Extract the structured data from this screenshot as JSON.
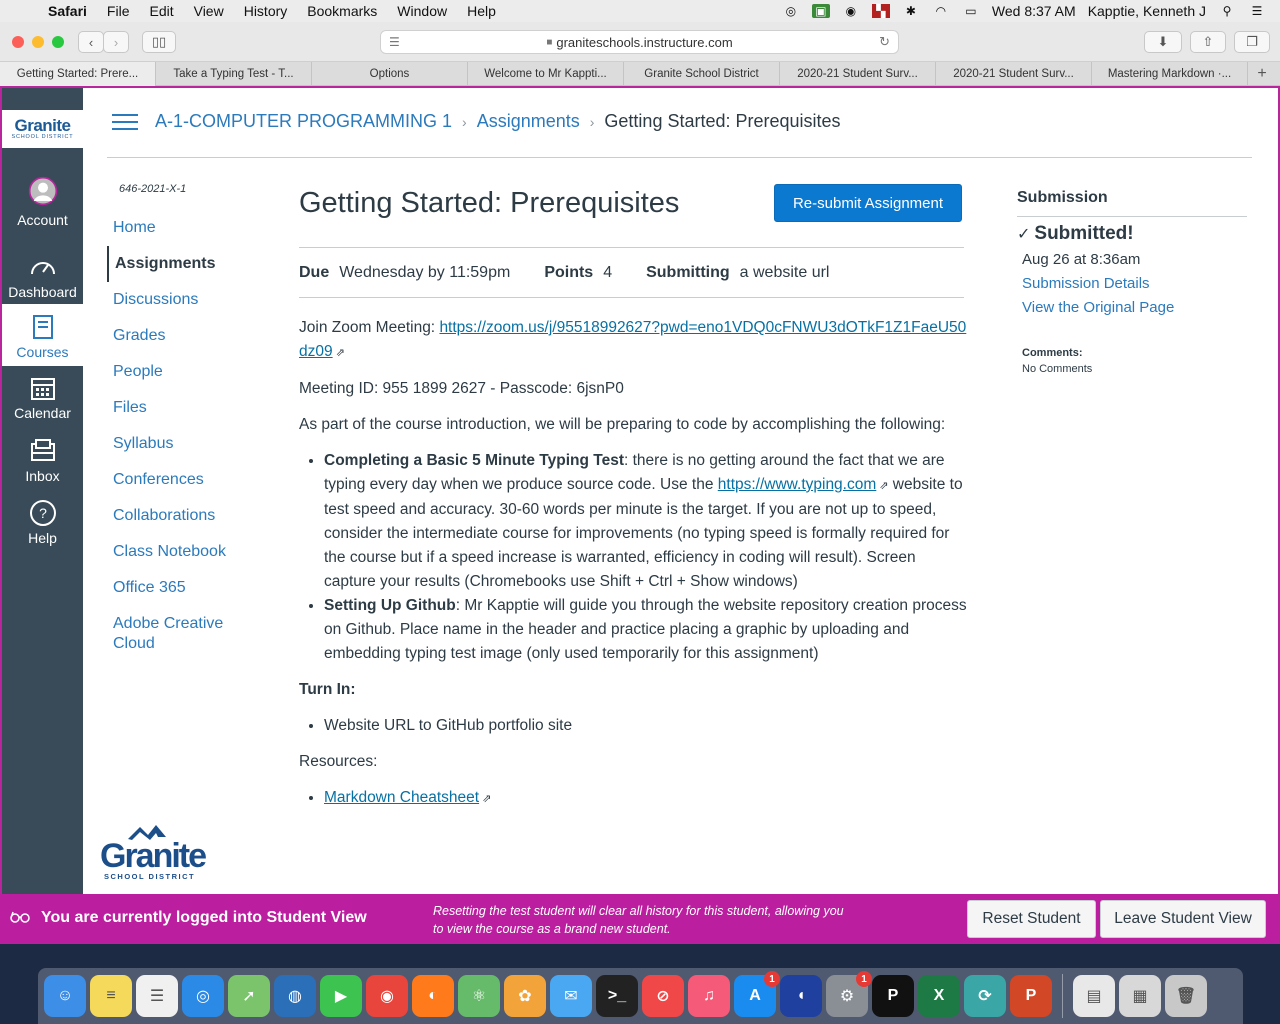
{
  "menubar": {
    "app": "Safari",
    "items": [
      "File",
      "Edit",
      "View",
      "History",
      "Bookmarks",
      "Window",
      "Help"
    ],
    "clock": "Wed 8:37 AM",
    "user": "Kapptie, Kenneth J"
  },
  "browser": {
    "url": "graniteschools.instructure.com",
    "tabs": [
      "Getting Started: Prere...",
      "Take a Typing Test - T...",
      "Options",
      "Welcome to Mr Kappti...",
      "Granite School District",
      "2020-21 Student Surv...",
      "2020-21 Student Surv...",
      "Mastering Markdown ·..."
    ]
  },
  "global_nav": {
    "logo_word": "Granite",
    "logo_sub": "SCHOOL DISTRICT",
    "items": [
      {
        "label": "Account",
        "icon": "avatar-icon"
      },
      {
        "label": "Dashboard",
        "icon": "dashboard-icon"
      },
      {
        "label": "Courses",
        "icon": "courses-icon"
      },
      {
        "label": "Calendar",
        "icon": "calendar-icon"
      },
      {
        "label": "Inbox",
        "icon": "inbox-icon"
      },
      {
        "label": "Help",
        "icon": "help-icon"
      }
    ]
  },
  "breadcrumb": {
    "course": "A-1-COMPUTER PROGRAMMING 1",
    "section": "Assignments",
    "current": "Getting Started: Prerequisites"
  },
  "course_nav": {
    "code": "646-2021-X-1",
    "items": [
      "Home",
      "Assignments",
      "Discussions",
      "Grades",
      "People",
      "Files",
      "Syllabus",
      "Conferences",
      "Collaborations",
      "Class Notebook",
      "Office 365",
      "Adobe Creative Cloud"
    ],
    "active": "Assignments"
  },
  "assignment": {
    "title": "Getting Started: Prerequisites",
    "resubmit_label": "Re-submit Assignment",
    "due_label": "Due",
    "due_value": "Wednesday by 11:59pm",
    "points_label": "Points",
    "points_value": "4",
    "submitting_label": "Submitting",
    "submitting_value": "a website url",
    "zoom_prefix": "Join Zoom Meeting: ",
    "zoom_link": "https://zoom.us/j/95518992627?pwd=eno1VDQ0cFNWU3dOTkF1Z1FaeU50dz09",
    "meeting_id": "Meeting ID: 955 1899 2627 - Passcode: 6jsnP0",
    "intro": "As part of the course introduction, we will be preparing to code by accomplishing the following:",
    "task1_title": "Completing a Basic 5 Minute Typing Test",
    "task1_text_a": ": there is no getting around the fact that we are typing every day when we produce source code. Use the ",
    "task1_link": "https://www.typing.com",
    "task1_text_b": " website to test speed and accuracy. 30-60 words per minute is the target. If you are not up to speed, consider the intermediate course for improvements (no typing speed is formally required for the course but if a speed increase is warranted, efficiency in coding will result). Screen capture your results (Chromebooks use Shift + Ctrl + Show windows)",
    "task2_title": "Setting Up Github",
    "task2_text": ": Mr Kapptie will guide you through the website repository creation process on Github. Place name in the header and practice placing a graphic by uploading and embedding typing test image (only used temporarily for this assignment)",
    "turnin_heading": "Turn In:",
    "turnin_item": "Website URL to GitHub portfolio site",
    "resources_heading": "Resources:",
    "resource_link": "Markdown Cheatsheet"
  },
  "submission": {
    "heading": "Submission",
    "status": "Submitted!",
    "date": "Aug 26 at 8:36am",
    "details_link": "Submission Details",
    "original_link": "View the Original Page",
    "comments_label": "Comments:",
    "comments_value": "No Comments"
  },
  "student_view": {
    "message": "You are currently logged into Student View",
    "note": "Resetting the test student will clear all history for this student, allowing you to view the course as a brand new student.",
    "reset_label": "Reset Student",
    "leave_label": "Leave Student View"
  },
  "dock": {
    "apps": [
      {
        "icon": "finder-icon",
        "color": "#3d8ee6",
        "glyph": "☺"
      },
      {
        "icon": "notes-icon",
        "color": "#f5d95a",
        "glyph": "≡"
      },
      {
        "icon": "reminders-icon",
        "color": "#f0f0f0",
        "glyph": "☰"
      },
      {
        "icon": "safari-icon",
        "color": "#2b8ae6",
        "glyph": "◎"
      },
      {
        "icon": "maps-icon",
        "color": "#7cc46c",
        "glyph": "➚"
      },
      {
        "icon": "network-icon",
        "color": "#2a6fb8",
        "glyph": "◍"
      },
      {
        "icon": "facetime-icon",
        "color": "#3cc350",
        "glyph": "▶"
      },
      {
        "icon": "chrome-icon",
        "color": "#e8453c",
        "glyph": "◉"
      },
      {
        "icon": "firefox-icon",
        "color": "#ff7a1a",
        "glyph": "◐"
      },
      {
        "icon": "atom-icon",
        "color": "#66bb6a",
        "glyph": "⚛"
      },
      {
        "icon": "photos-icon",
        "color": "#f2a43a",
        "glyph": "✿"
      },
      {
        "icon": "messages-icon",
        "color": "#4aa8f2",
        "glyph": "✉"
      },
      {
        "icon": "terminal-icon",
        "color": "#222222",
        "glyph": ">_"
      },
      {
        "icon": "news-icon",
        "color": "#f04848",
        "glyph": "⊘"
      },
      {
        "icon": "music-icon",
        "color": "#f55a78",
        "glyph": "♫"
      },
      {
        "icon": "appstore-icon",
        "color": "#1a8cf0",
        "glyph": "A",
        "badge": "1"
      },
      {
        "icon": "audacity-icon",
        "color": "#2040a0",
        "glyph": "◖"
      },
      {
        "icon": "system-preferences-icon",
        "color": "#8a8f96",
        "glyph": "⚙",
        "badge": "1"
      },
      {
        "icon": "processing-icon",
        "color": "#111111",
        "glyph": "P"
      },
      {
        "icon": "excel-icon",
        "color": "#1e7a44",
        "glyph": "X"
      },
      {
        "icon": "sync-icon",
        "color": "#3aa6a6",
        "glyph": "⟳"
      },
      {
        "icon": "powerpoint-icon",
        "color": "#d24726",
        "glyph": "P"
      },
      {
        "icon": "xls-file-icon",
        "color": "#e8e8e8",
        "glyph": "▤"
      },
      {
        "icon": "spreadsheet-file-icon",
        "color": "#d8d8d8",
        "glyph": "▦"
      },
      {
        "icon": "trash-icon",
        "color": "#c8c8c8",
        "glyph": "🗑"
      }
    ],
    "separator_after": [
      21
    ]
  }
}
